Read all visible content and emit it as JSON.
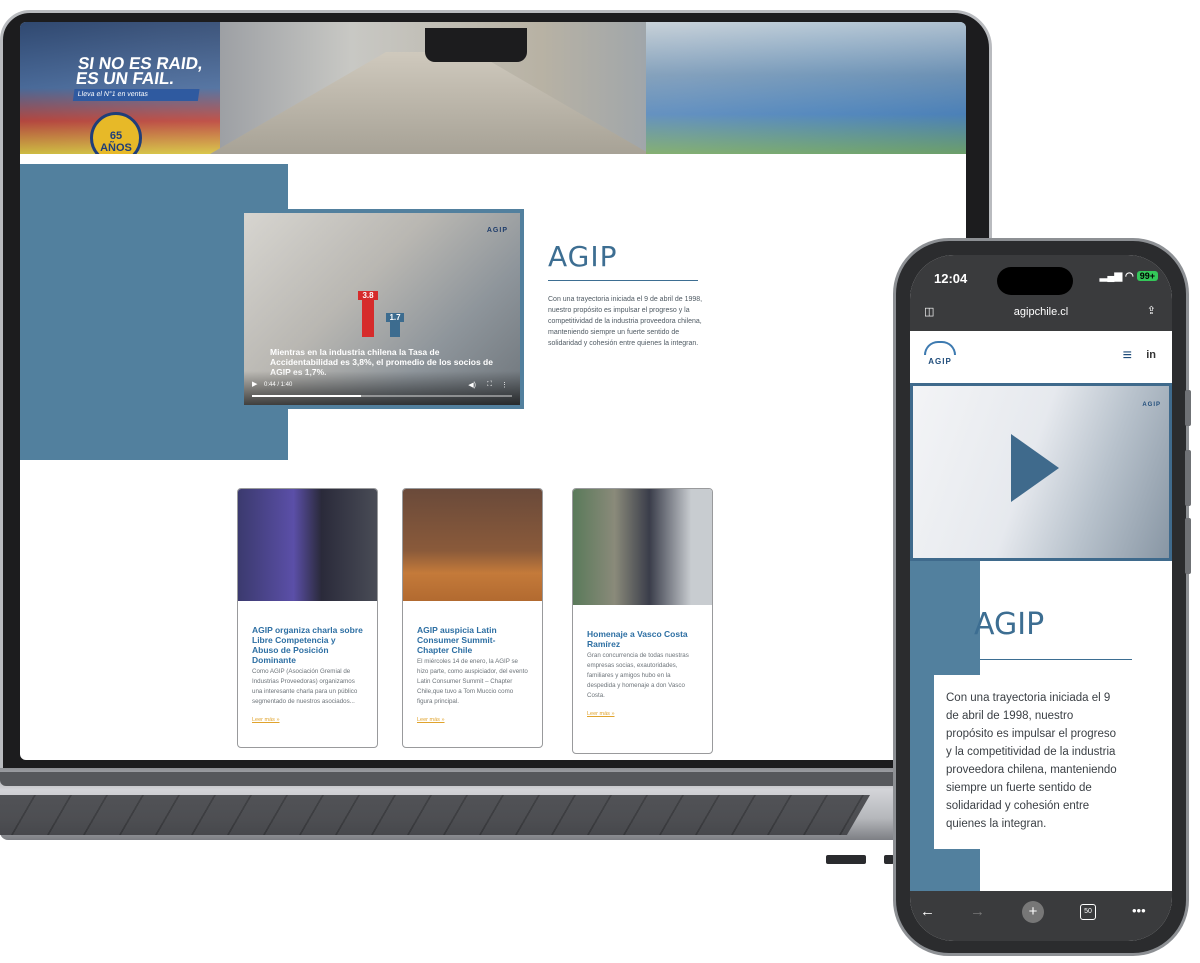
{
  "laptop": {
    "hero": {
      "promo_line1": "SI NO ES RAID,",
      "promo_line2": "ES UN FAIL.",
      "promo_sub": "Lleva el N°1 en ventas",
      "badge": "65 AÑOS"
    },
    "video": {
      "logo": "AGIP",
      "bar_red_value": "3.8",
      "bar_blue_value": "1.7",
      "caption": "Mientras en la industria chilena la Tasa de Accidentabilidad es 3,8%, el promedio de los socios de AGIP es 1,7%.",
      "time": "0:44 / 1:40",
      "progress": 0.44
    },
    "about": {
      "title": "AGIP",
      "description": "Con una trayectoria iniciada el 9 de abril de 1998, nuestro propósito es impulsar el progreso y la competitividad de la industria proveedora chilena, manteniendo siempre un fuerte sentido de solidaridad y cohesión entre quienes la integran."
    },
    "news": [
      {
        "title": "AGIP organiza charla sobre Libre Competencia y Abuso de Posición Dominante",
        "text": "Como AGIP (Asociación Gremial de Industrias Proveedoras) organizamos una interesante charla para un público segmentado de nuestros asociados...",
        "more": "Leer más »"
      },
      {
        "title": "AGIP auspicia Latin Consumer Summit- Chapter Chile",
        "text": "El miércoles 14 de enero, la AGIP se hizo parte, como auspiciador, del evento Latin Consumer Summit – Chapter Chile,que tuvo a Tom Muccio como figura principal.",
        "more": "Leer más »"
      },
      {
        "title": "Homenaje a Vasco Costa Ramírez",
        "text": "Gran concurrencia de todas nuestras empresas socias, exautoridades, familiares y amigos hubo en la despedida y homenaje a don Vasco Costa.",
        "more": "Leer más »"
      }
    ]
  },
  "phone": {
    "status": {
      "time": "12:04",
      "battery": "99+"
    },
    "url": "agipchile.cl",
    "nav": {
      "logo": "AGIP",
      "linkedin": "in"
    },
    "video_logo": "AGIP",
    "about": {
      "title": "AGIP",
      "description": "Con una trayectoria iniciada el 9 de abril de 1998, nuestro propósito es impulsar el progreso y la competitividad de la industria proveedora chilena, manteniendo siempre un fuerte sentido de solidaridad y cohesión entre quienes la integran."
    },
    "toolbar": {
      "tabs_count": "50"
    }
  },
  "colors": {
    "brand_blue": "#52809e",
    "title_blue": "#3d6e92",
    "link_orange": "#e0a32c"
  }
}
